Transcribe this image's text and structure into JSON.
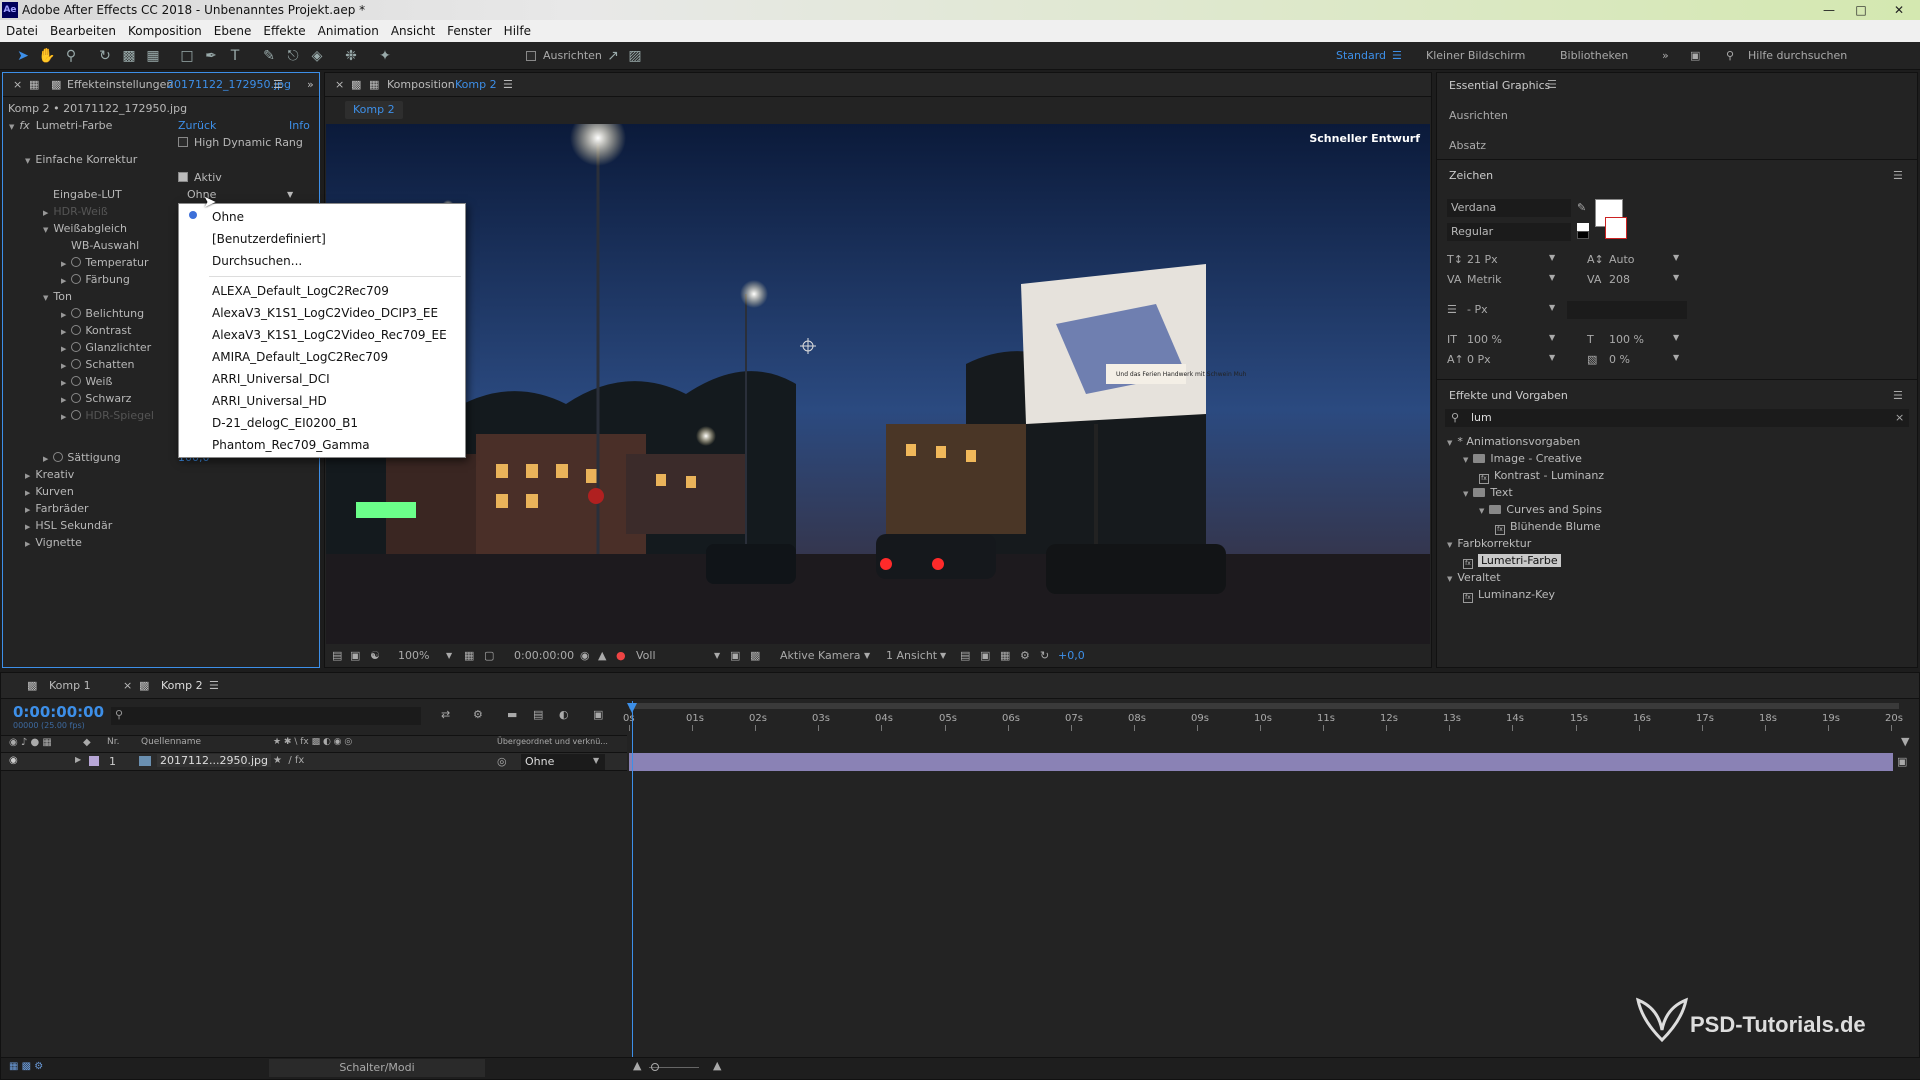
{
  "window": {
    "title": "Adobe After Effects CC 2018 - Unbenanntes Projekt.aep *",
    "logo": "Ae"
  },
  "menu": [
    "Datei",
    "Bearbeiten",
    "Komposition",
    "Ebene",
    "Effekte",
    "Animation",
    "Ansicht",
    "Fenster",
    "Hilfe"
  ],
  "toolbar": {
    "snap_label": "Ausrichten",
    "workspaces": [
      "Standard",
      "Kleiner Bildschirm",
      "Bibliotheken"
    ],
    "help_search": "Hilfe durchsuchen"
  },
  "effects_panel": {
    "tab_label": "Effekteinstellungen",
    "tab_file": "20171122_172950.jpg",
    "breadcrumb": "Komp 2 • 20171122_172950.jpg",
    "effect_name": "Lumetri-Farbe",
    "back": "Zurück",
    "info": "Info",
    "hdr": "High Dynamic Rang",
    "section_basic": "Einfache Korrektur",
    "active": "Aktiv",
    "input_lut_label": "Eingabe-LUT",
    "input_lut_value": "Ohne",
    "hdr_white": "HDR-Weiß",
    "white_balance": "Weißabgleich",
    "wb_select": "WB-Auswahl",
    "temperature": "Temperatur",
    "tint": "Färbung",
    "tone": "Ton",
    "exposure": "Belichtung",
    "contrast": "Kontrast",
    "highlights": "Glanzlichter",
    "shadows": "Schatten",
    "whites": "Weiß",
    "blacks": "Schwarz",
    "hdr_specular": "HDR-Spiegel",
    "saturation": "Sättigung",
    "saturation_value": "100,0",
    "sections": [
      "Kreativ",
      "Kurven",
      "Farbräder",
      "HSL Sekundär",
      "Vignette"
    ]
  },
  "lut_dropdown": {
    "selected": "Ohne",
    "items_top": [
      "Ohne",
      "[Benutzerdefiniert]",
      "Durchsuchen..."
    ],
    "items_lut": [
      "ALEXA_Default_LogC2Rec709",
      "AlexaV3_K1S1_LogC2Video_DCIP3_EE",
      "AlexaV3_K1S1_LogC2Video_Rec709_EE",
      "AMIRA_Default_LogC2Rec709",
      "ARRI_Universal_DCI",
      "ARRI_Universal_HD",
      "D-21_delogC_EI0200_B1",
      "Phantom_Rec709_Gamma"
    ]
  },
  "composition": {
    "tab_label": "Komposition",
    "tab_name": "Komp 2",
    "sub_tab": "Komp 2",
    "draft_label": "Schneller Entwurf",
    "zoom": "100%",
    "timecode": "0:00:00:00",
    "resolution": "Voll",
    "camera": "Aktive Kamera",
    "views": "1 Ansicht",
    "exposure": "+0,0",
    "billboard_text": "Und das Ferien\nHandwerk mit Schwein Muh"
  },
  "right_panel": {
    "eg_title": "Essential Graphics",
    "align": "Ausrichten",
    "paragraph": "Absatz",
    "character": "Zeichen",
    "font": "Verdana",
    "style": "Regular",
    "size": "21 Px",
    "leading": "Auto",
    "kerning": "Metrik",
    "tracking": "208",
    "stroke": "- Px",
    "vscale": "100 %",
    "hscale": "100 %",
    "baseline": "0 Px",
    "tsume": "0 %",
    "fx_title": "Effekte und Vorgaben",
    "search": "lum",
    "tree": [
      {
        "label": "* Animationsvorgaben",
        "indent": 0,
        "type": "open"
      },
      {
        "label": "Image - Creative",
        "indent": 1,
        "type": "folder"
      },
      {
        "label": "Kontrast - Luminanz",
        "indent": 2,
        "type": "fx"
      },
      {
        "label": "Text",
        "indent": 1,
        "type": "folder"
      },
      {
        "label": "Curves and Spins",
        "indent": 2,
        "type": "folder"
      },
      {
        "label": "Blühende Blume",
        "indent": 3,
        "type": "fx"
      },
      {
        "label": "Farbkorrektur",
        "indent": 0,
        "type": "open"
      },
      {
        "label": "Lumetri-Farbe",
        "indent": 1,
        "type": "fx",
        "selected": true
      },
      {
        "label": "Veraltet",
        "indent": 0,
        "type": "open"
      },
      {
        "label": "Luminanz-Key",
        "indent": 1,
        "type": "fx"
      }
    ]
  },
  "timeline": {
    "tabs": [
      "Komp 1",
      "Komp 2"
    ],
    "timecode": "0:00:00:00",
    "timecode_sub": "00000 (25.00 fps)",
    "col_nr": "Nr.",
    "col_source": "Quellenname",
    "col_parent": "Übergeordnet und verknü...",
    "layer_num": "1",
    "layer_name": "2017112...2950.jpg",
    "layer_parent": "Ohne",
    "ruler": [
      "0s",
      "01s",
      "02s",
      "03s",
      "04s",
      "05s",
      "06s",
      "07s",
      "08s",
      "09s",
      "10s",
      "11s",
      "12s",
      "13s",
      "14s",
      "15s",
      "16s",
      "17s",
      "18s",
      "19s",
      "20s"
    ],
    "footer": "Schalter/Modi"
  },
  "watermark": "PSD-Tutorials.de"
}
